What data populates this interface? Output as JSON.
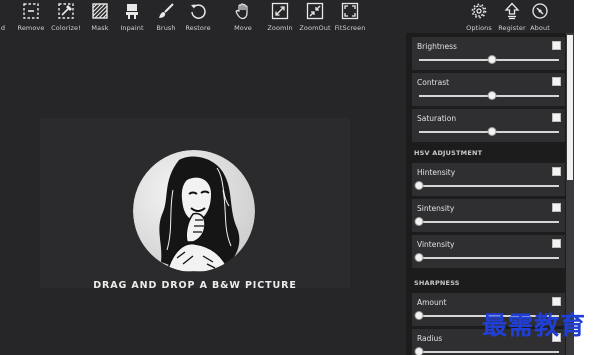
{
  "toolbar": {
    "left_tools": [
      {
        "name": "load",
        "label": "d",
        "icon": "load-icon"
      },
      {
        "name": "remove",
        "label": "Remove",
        "icon": "remove-icon"
      },
      {
        "name": "colorize",
        "label": "Colorize!",
        "icon": "colorize-icon"
      },
      {
        "name": "mask",
        "label": "Mask",
        "icon": "mask-icon"
      },
      {
        "name": "inpaint",
        "label": "Inpaint",
        "icon": "inpaint-icon"
      },
      {
        "name": "brush",
        "label": "Brush",
        "icon": "brush-icon"
      },
      {
        "name": "restore",
        "label": "Restore",
        "icon": "restore-icon"
      },
      {
        "name": "move",
        "label": "Move",
        "icon": "hand-icon"
      },
      {
        "name": "zoomin",
        "label": "ZoomIn",
        "icon": "zoom-in-icon"
      },
      {
        "name": "zoomout",
        "label": "ZoomOut",
        "icon": "zoom-out-icon"
      },
      {
        "name": "fitscreen",
        "label": "FitScreen",
        "icon": "fit-screen-icon"
      }
    ],
    "right_tools": [
      {
        "name": "options",
        "label": "Options",
        "icon": "gear-icon"
      },
      {
        "name": "register",
        "label": "Register",
        "icon": "upload-icon"
      },
      {
        "name": "about",
        "label": "About",
        "icon": "compass-icon"
      }
    ]
  },
  "canvas": {
    "drop_text": "DRAG AND DROP A B&W PICTURE"
  },
  "panel": {
    "basic": [
      {
        "label": "Brightness",
        "level": 0.52,
        "checked": false
      },
      {
        "label": "Contrast",
        "level": 0.52,
        "checked": false
      },
      {
        "label": "Saturation",
        "level": 0.52,
        "checked": false
      }
    ],
    "hsv_title": "HSV ADJUSTMENT",
    "hsv": [
      {
        "label": "Hintensity",
        "level": 0.0,
        "checked": false
      },
      {
        "label": "Sintensity",
        "level": 0.0,
        "checked": false
      },
      {
        "label": "Vintensity",
        "level": 0.0,
        "checked": false
      }
    ],
    "sharpness_title": "SHARPNESS",
    "sharpness": [
      {
        "label": "Amount",
        "level": 0.0,
        "checked": false
      },
      {
        "label": "Radius",
        "level": 0.0,
        "checked": false
      }
    ]
  },
  "watermark": "最需教育",
  "colors": {
    "background": "#262628",
    "panel": "#1c1c1d",
    "row": "#2f2f31",
    "watermark": "#1f3fd6"
  }
}
